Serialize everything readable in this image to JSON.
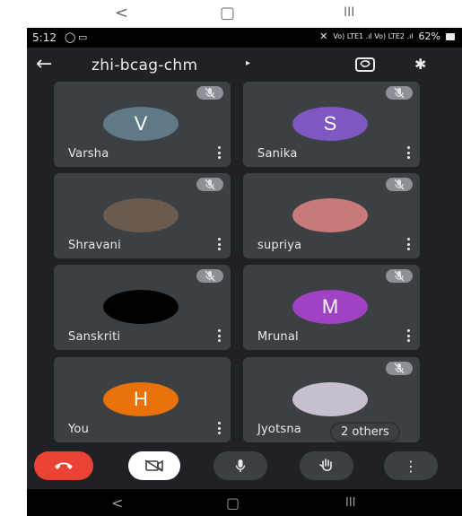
{
  "top_nav": {
    "back": "<",
    "home": "▢",
    "recents": "III"
  },
  "status_bar": {
    "time": "5:12",
    "signal_text": "Vo) LTE1 .ıl Vo) LTE2 .ıl",
    "battery": "62%"
  },
  "app_bar": {
    "meeting_code": "zhi-bcag-chm",
    "caret": "▸"
  },
  "participants": [
    {
      "name": "Varsha",
      "avatar_letter": "V",
      "avatar_color": "#5f7a86",
      "muted": true
    },
    {
      "name": "Sanika",
      "avatar_letter": "S",
      "avatar_color": "#7e57c2",
      "muted": true
    },
    {
      "name": "Shravani",
      "avatar_letter": "",
      "avatar_color": "#6b5a4e",
      "muted": true
    },
    {
      "name": "supriya",
      "avatar_letter": "",
      "avatar_color": "#c97a7a",
      "muted": true
    },
    {
      "name": "Sanskriti",
      "avatar_letter": "",
      "avatar_color": "#000000",
      "muted": true
    },
    {
      "name": "Mrunal",
      "avatar_letter": "M",
      "avatar_color": "#a142c4",
      "muted": true
    },
    {
      "name": "You",
      "avatar_letter": "H",
      "avatar_color": "#e8710a",
      "muted": false
    },
    {
      "name": "Jyotsna",
      "avatar_letter": "",
      "avatar_color": "#c9c0cf",
      "muted": true,
      "others_label": "2 others"
    }
  ],
  "controls": {
    "end_call_color": "#ea4335",
    "camera_off_bg": "#ffffff",
    "control_bg": "#3c4043",
    "kebab": "⋮"
  },
  "bottom_nav": {
    "back": "<",
    "home": "▢",
    "recents": "III"
  }
}
